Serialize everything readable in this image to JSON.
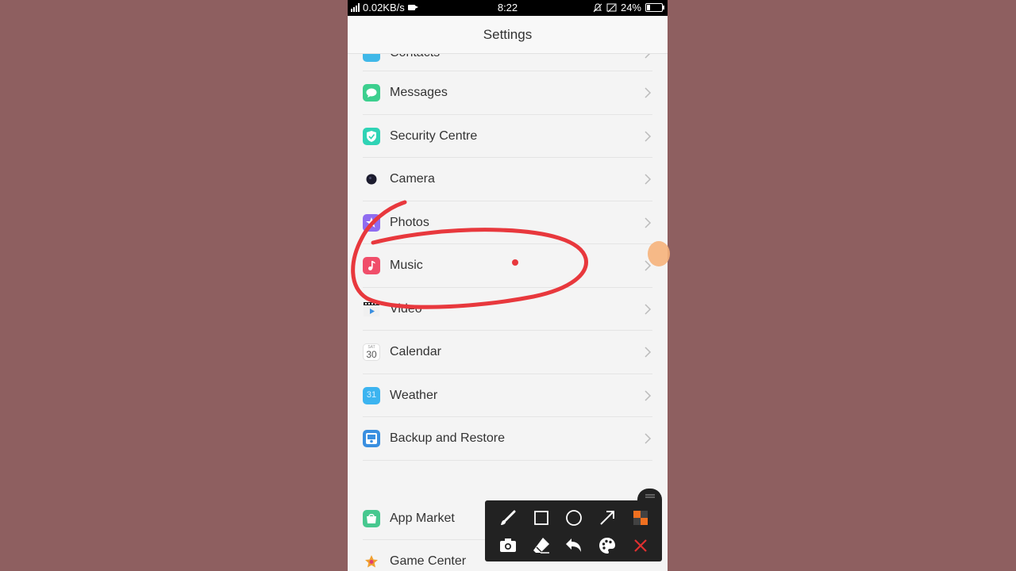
{
  "status_bar": {
    "speed": "0.02KB/s",
    "time": "8:22",
    "battery_percent": "24%",
    "battery_level": 0.24
  },
  "header": {
    "title": "Settings"
  },
  "settings": {
    "partial_item": {
      "label": "Contacts"
    },
    "items": [
      {
        "label": "Messages",
        "icon": "messages-icon",
        "color": "#3ccf8e"
      },
      {
        "label": "Security Centre",
        "icon": "shield-icon",
        "color": "#2fd3b5"
      },
      {
        "label": "Camera",
        "icon": "camera-icon",
        "color": "#1c1c2e"
      },
      {
        "label": "Photos",
        "icon": "photos-icon",
        "color": "#8f6cf0"
      },
      {
        "label": "Music",
        "icon": "music-icon",
        "color": "#f04e6a"
      },
      {
        "label": "Video",
        "icon": "video-icon",
        "color": "#3a8fe0"
      },
      {
        "label": "Calendar",
        "icon": "calendar-icon",
        "color": "#777777",
        "day": "SAT",
        "date": "30"
      },
      {
        "label": "Weather",
        "icon": "weather-icon",
        "color": "#3cb4f0",
        "value": "31"
      },
      {
        "label": "Backup and Restore",
        "icon": "backup-icon",
        "color": "#3a8fe0"
      }
    ],
    "apps": [
      {
        "label": "App Market",
        "icon": "app-market-icon",
        "color": "#47c88f"
      },
      {
        "label": "Game Center",
        "icon": "game-center-icon",
        "color": "#f0a030"
      }
    ]
  },
  "annotation_toolbar": {
    "tools": [
      {
        "name": "brush-icon"
      },
      {
        "name": "rectangle-icon"
      },
      {
        "name": "circle-icon"
      },
      {
        "name": "arrow-icon"
      },
      {
        "name": "mosaic-icon"
      },
      {
        "name": "screenshot-icon"
      },
      {
        "name": "eraser-icon"
      },
      {
        "name": "undo-icon"
      },
      {
        "name": "palette-icon"
      },
      {
        "name": "close-icon"
      }
    ],
    "close_color": "#e03030",
    "mosaic_color": "#f07020"
  },
  "annotation": {
    "stroke_color": "#e8383d"
  }
}
